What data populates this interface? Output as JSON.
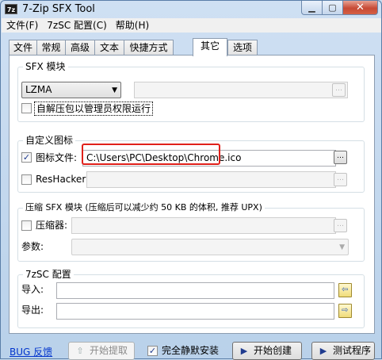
{
  "window": {
    "title": "7-Zip SFX Tool",
    "icon_text": "7z"
  },
  "menubar": [
    {
      "label": "文件(F)"
    },
    {
      "label": "7zSC 配置(C)"
    },
    {
      "label": "帮助(H)"
    }
  ],
  "tabs": [
    {
      "label": "文件"
    },
    {
      "label": "常规"
    },
    {
      "label": "高级"
    },
    {
      "label": "文本"
    },
    {
      "label": "快捷方式"
    },
    {
      "label": "其它",
      "active": true
    },
    {
      "label": "选项"
    }
  ],
  "sfx_module": {
    "group_title": "SFX 模块",
    "selected": "LZMA",
    "path_value": "",
    "run_as_admin_label": "自解压包以管理员权限运行",
    "run_as_admin_checked": false
  },
  "custom_icon": {
    "group_title": "自定义图标",
    "icon_file_label": "图标文件:",
    "icon_file_checked": true,
    "icon_file_value": "C:\\Users\\PC\\Desktop\\Chrome.ico",
    "reshacker_label": "ResHacker:",
    "reshacker_checked": false,
    "reshacker_value": ""
  },
  "compress_sfx": {
    "group_title": "压缩 SFX 模块 (压缩后可以减少约 50 KB 的体积, 推荐 UPX)",
    "compressor_label": "压缩器:",
    "compressor_checked": false,
    "compressor_value": "",
    "params_label": "参数:",
    "params_value": ""
  },
  "zsc_config": {
    "group_title": "7zSC 配置",
    "import_label": "导入:",
    "import_value": "",
    "export_label": "导出:",
    "export_value": ""
  },
  "bottom": {
    "bug_link": "BUG 反馈",
    "start_extract_label": "开始提取",
    "silent_install_label": "完全静默安装",
    "silent_install_checked": true,
    "start_create_label": "开始创建",
    "test_program_label": "测试程序"
  }
}
